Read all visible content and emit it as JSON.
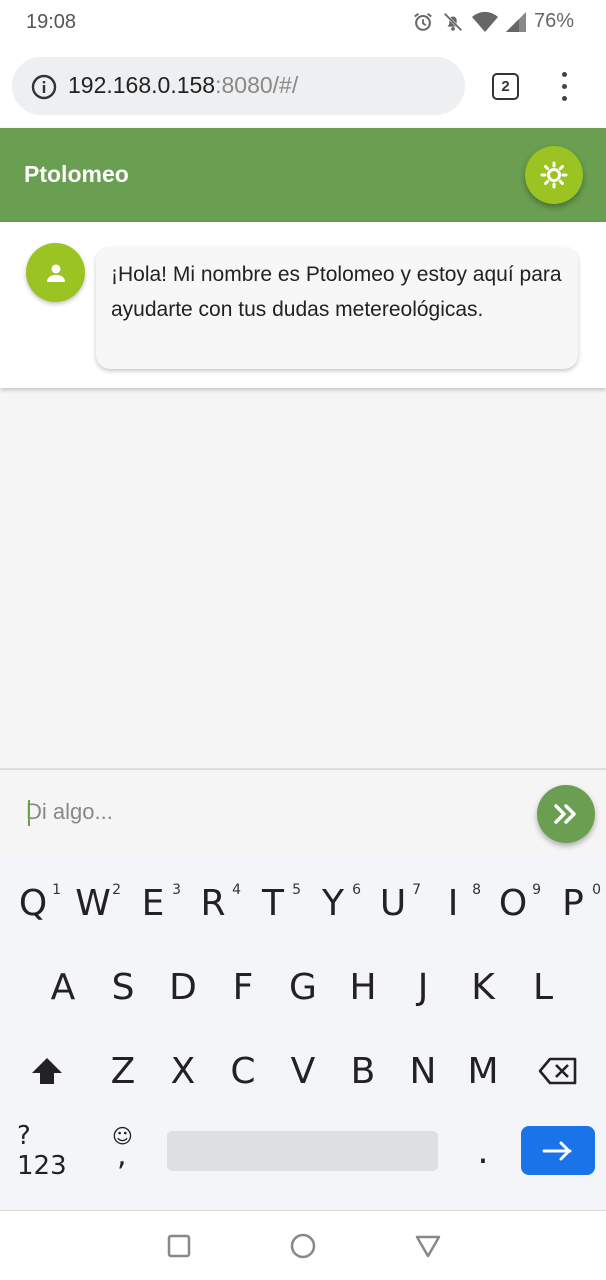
{
  "status_bar": {
    "time": "19:08",
    "battery": "76%",
    "icons": [
      "alarm-icon",
      "bell-off-icon",
      "wifi-icon",
      "signal-icon"
    ]
  },
  "browser": {
    "url_host": "192.168.0.158",
    "url_rest": ":8080/#/",
    "tab_count": "2"
  },
  "app": {
    "title": "Ptolomeo",
    "accent_color": "#6a9e50",
    "lime_color": "#9bc322"
  },
  "chat": {
    "messages": [
      {
        "text": "¡Hola! Mi nombre es Ptolomeo y estoy aquí para ayudarte con tus dudas metereológicas."
      }
    ]
  },
  "input": {
    "placeholder": "Di algo...",
    "value": ""
  },
  "keyboard": {
    "row1": [
      "Q",
      "W",
      "E",
      "R",
      "T",
      "Y",
      "U",
      "I",
      "O",
      "P"
    ],
    "row1_hints": [
      "1",
      "2",
      "3",
      "4",
      "5",
      "6",
      "7",
      "8",
      "9",
      "0"
    ],
    "row2": [
      "A",
      "S",
      "D",
      "F",
      "G",
      "H",
      "J",
      "K",
      "L"
    ],
    "row3": [
      "Z",
      "X",
      "C",
      "V",
      "B",
      "N",
      "M"
    ],
    "symbols_label": "?123",
    "comma": ",",
    "period": ".",
    "emoji_glyph": "☺"
  }
}
